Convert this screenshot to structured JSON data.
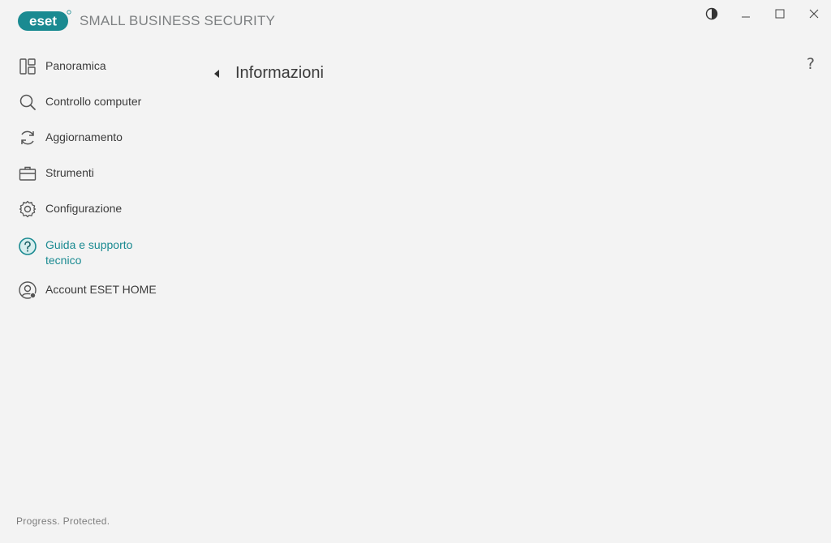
{
  "app": {
    "logo_text": "eset",
    "product_name": "SMALL BUSINESS SECURITY",
    "brand_color": "#1a8a91"
  },
  "window_controls": {
    "theme_icon": "contrast-icon",
    "minimize_icon": "minimize-icon",
    "maximize_icon": "maximize-icon",
    "close_icon": "close-icon"
  },
  "sidebar": {
    "items": [
      {
        "label": "Panoramica",
        "icon": "dashboard-icon"
      },
      {
        "label": "Controllo computer",
        "icon": "search-icon"
      },
      {
        "label": "Aggiornamento",
        "icon": "refresh-icon"
      },
      {
        "label": "Strumenti",
        "icon": "briefcase-icon"
      },
      {
        "label": "Configurazione",
        "icon": "gear-icon"
      },
      {
        "label": "Guida e supporto tecnico",
        "icon": "help-circle-icon",
        "active": true
      },
      {
        "label": "Account ESET HOME",
        "icon": "account-icon"
      }
    ]
  },
  "main": {
    "title": "Informazioni",
    "help_label": "?"
  },
  "footer": {
    "tagline": "Progress. Protected."
  }
}
